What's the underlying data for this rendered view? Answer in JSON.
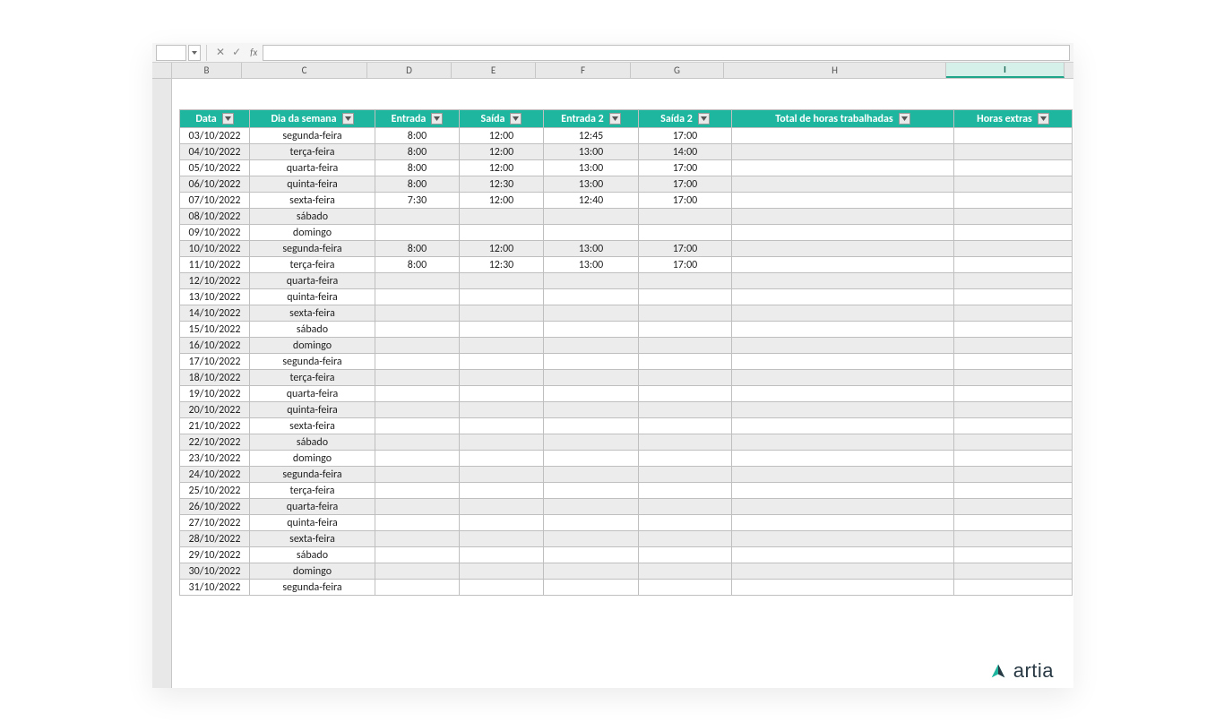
{
  "formulaBar": {
    "name": "",
    "fx": "fx",
    "formula": ""
  },
  "columnLetters": [
    "B",
    "C",
    "D",
    "E",
    "F",
    "G",
    "H",
    "I"
  ],
  "activeColumn": "I",
  "headers": {
    "B": "Data",
    "C": "Dia da semana",
    "D": "Entrada",
    "E": "Saída",
    "F": "Entrada 2",
    "G": "Saída 2",
    "H": "Total de horas trabalhadas",
    "I": "Horas extras"
  },
  "rows": [
    {
      "B": "03/10/2022",
      "C": "segunda-feira",
      "D": "8:00",
      "E": "12:00",
      "F": "12:45",
      "G": "17:00",
      "H": "",
      "I": ""
    },
    {
      "B": "04/10/2022",
      "C": "terça-feira",
      "D": "8:00",
      "E": "12:00",
      "F": "13:00",
      "G": "14:00",
      "H": "",
      "I": ""
    },
    {
      "B": "05/10/2022",
      "C": "quarta-feira",
      "D": "8:00",
      "E": "12:00",
      "F": "13:00",
      "G": "17:00",
      "H": "",
      "I": ""
    },
    {
      "B": "06/10/2022",
      "C": "quinta-feira",
      "D": "8:00",
      "E": "12:30",
      "F": "13:00",
      "G": "17:00",
      "H": "",
      "I": ""
    },
    {
      "B": "07/10/2022",
      "C": "sexta-feira",
      "D": "7:30",
      "E": "12:00",
      "F": "12:40",
      "G": "17:00",
      "H": "",
      "I": ""
    },
    {
      "B": "08/10/2022",
      "C": "sábado",
      "D": "",
      "E": "",
      "F": "",
      "G": "",
      "H": "",
      "I": ""
    },
    {
      "B": "09/10/2022",
      "C": "domingo",
      "D": "",
      "E": "",
      "F": "",
      "G": "",
      "H": "",
      "I": ""
    },
    {
      "B": "10/10/2022",
      "C": "segunda-feira",
      "D": "8:00",
      "E": "12:00",
      "F": "13:00",
      "G": "17:00",
      "H": "",
      "I": ""
    },
    {
      "B": "11/10/2022",
      "C": "terça-feira",
      "D": "8:00",
      "E": "12:30",
      "F": "13:00",
      "G": "17:00",
      "H": "",
      "I": ""
    },
    {
      "B": "12/10/2022",
      "C": "quarta-feira",
      "D": "",
      "E": "",
      "F": "",
      "G": "",
      "H": "",
      "I": ""
    },
    {
      "B": "13/10/2022",
      "C": "quinta-feira",
      "D": "",
      "E": "",
      "F": "",
      "G": "",
      "H": "",
      "I": ""
    },
    {
      "B": "14/10/2022",
      "C": "sexta-feira",
      "D": "",
      "E": "",
      "F": "",
      "G": "",
      "H": "",
      "I": ""
    },
    {
      "B": "15/10/2022",
      "C": "sábado",
      "D": "",
      "E": "",
      "F": "",
      "G": "",
      "H": "",
      "I": ""
    },
    {
      "B": "16/10/2022",
      "C": "domingo",
      "D": "",
      "E": "",
      "F": "",
      "G": "",
      "H": "",
      "I": ""
    },
    {
      "B": "17/10/2022",
      "C": "segunda-feira",
      "D": "",
      "E": "",
      "F": "",
      "G": "",
      "H": "",
      "I": ""
    },
    {
      "B": "18/10/2022",
      "C": "terça-feira",
      "D": "",
      "E": "",
      "F": "",
      "G": "",
      "H": "",
      "I": ""
    },
    {
      "B": "19/10/2022",
      "C": "quarta-feira",
      "D": "",
      "E": "",
      "F": "",
      "G": "",
      "H": "",
      "I": ""
    },
    {
      "B": "20/10/2022",
      "C": "quinta-feira",
      "D": "",
      "E": "",
      "F": "",
      "G": "",
      "H": "",
      "I": ""
    },
    {
      "B": "21/10/2022",
      "C": "sexta-feira",
      "D": "",
      "E": "",
      "F": "",
      "G": "",
      "H": "",
      "I": ""
    },
    {
      "B": "22/10/2022",
      "C": "sábado",
      "D": "",
      "E": "",
      "F": "",
      "G": "",
      "H": "",
      "I": ""
    },
    {
      "B": "23/10/2022",
      "C": "domingo",
      "D": "",
      "E": "",
      "F": "",
      "G": "",
      "H": "",
      "I": ""
    },
    {
      "B": "24/10/2022",
      "C": "segunda-feira",
      "D": "",
      "E": "",
      "F": "",
      "G": "",
      "H": "",
      "I": ""
    },
    {
      "B": "25/10/2022",
      "C": "terça-feira",
      "D": "",
      "E": "",
      "F": "",
      "G": "",
      "H": "",
      "I": ""
    },
    {
      "B": "26/10/2022",
      "C": "quarta-feira",
      "D": "",
      "E": "",
      "F": "",
      "G": "",
      "H": "",
      "I": ""
    },
    {
      "B": "27/10/2022",
      "C": "quinta-feira",
      "D": "",
      "E": "",
      "F": "",
      "G": "",
      "H": "",
      "I": ""
    },
    {
      "B": "28/10/2022",
      "C": "sexta-feira",
      "D": "",
      "E": "",
      "F": "",
      "G": "",
      "H": "",
      "I": ""
    },
    {
      "B": "29/10/2022",
      "C": "sábado",
      "D": "",
      "E": "",
      "F": "",
      "G": "",
      "H": "",
      "I": ""
    },
    {
      "B": "30/10/2022",
      "C": "domingo",
      "D": "",
      "E": "",
      "F": "",
      "G": "",
      "H": "",
      "I": ""
    },
    {
      "B": "31/10/2022",
      "C": "segunda-feira",
      "D": "",
      "E": "",
      "F": "",
      "G": "",
      "H": "",
      "I": ""
    }
  ],
  "logo": {
    "text": "artia"
  }
}
